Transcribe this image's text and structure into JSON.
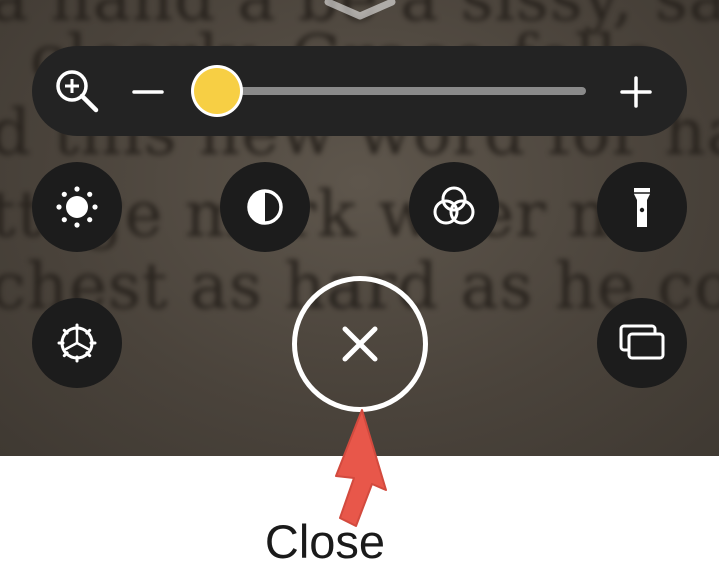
{
  "background_text": {
    "lines": [
      "a hand a be a sissy,  sa",
      "clearly, Grace      follo",
      "d this new word for hands",
      "ttage  mark  wher  n",
      "chest as hard as he could; th"
    ]
  },
  "colors": {
    "toolbar_bg": "#232323",
    "button_bg": "#1c1c1c",
    "slider_thumb": "#f7cf44",
    "slider_track": "#8a8a8a",
    "arrow": "#e8574a",
    "icon": "#ffffff"
  },
  "zoom": {
    "slider_level": 0.0
  },
  "icons": {
    "collapse": "chevron-down-icon",
    "zoom": "zoom-in-icon",
    "zoom_out": "minus-icon",
    "zoom_in": "plus-icon",
    "brightness": "brightness-sun-icon",
    "contrast": "contrast-icon",
    "filters": "color-filters-icon",
    "flashlight": "flashlight-icon",
    "settings": "settings-gear-icon",
    "multi_image": "multi-image-icon",
    "close": "close-x-icon",
    "callout": "red-arrow-pointer"
  },
  "annotation": {
    "label": "Close"
  }
}
